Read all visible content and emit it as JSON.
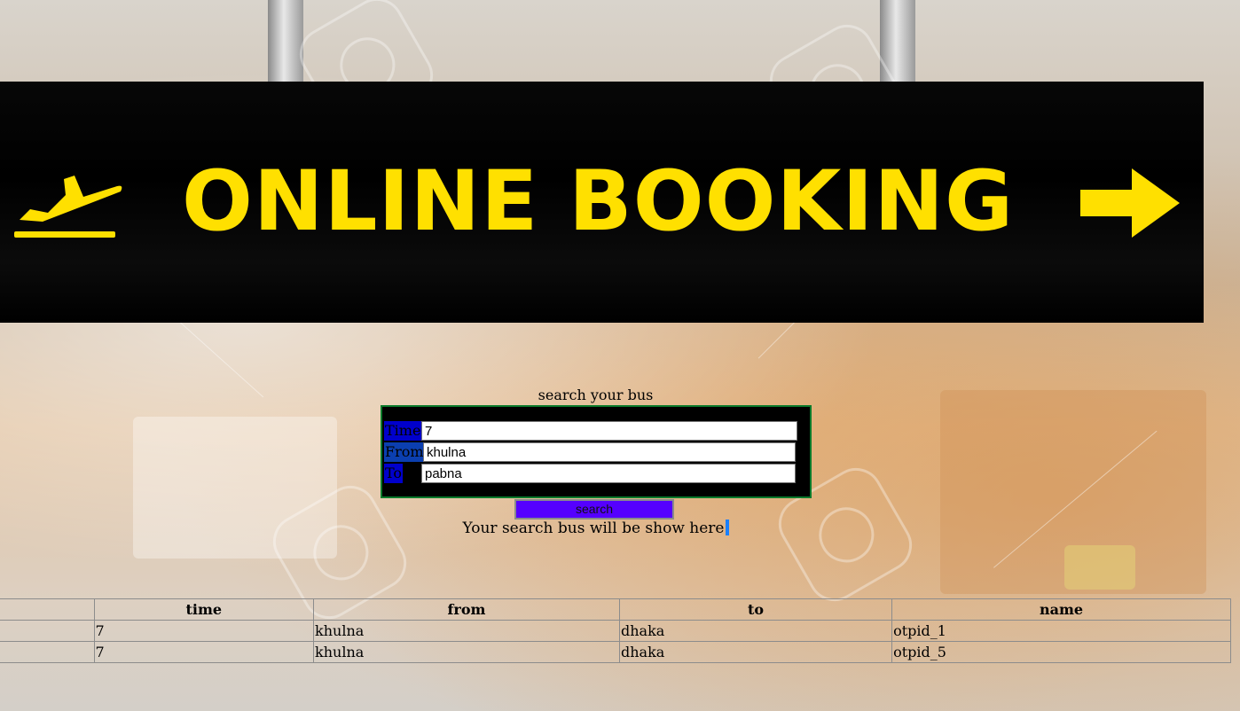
{
  "banner": {
    "title": "ONLINE BOOKING"
  },
  "search": {
    "caption": "search your bus",
    "fields": {
      "time": {
        "label": "Time",
        "value": "7"
      },
      "from": {
        "label": "From",
        "value": "khulna"
      },
      "to": {
        "label": "To",
        "value": "pabna"
      }
    },
    "button_label": "search",
    "result_message": "Your search bus will be show here"
  },
  "results": {
    "columns": [
      "time",
      "from",
      "to",
      "name"
    ],
    "rows": [
      [
        "7",
        "khulna",
        "dhaka",
        "otpid_1"
      ],
      [
        "7",
        "khulna",
        "dhaka",
        "otpid_5"
      ]
    ]
  },
  "colors": {
    "sign_text": "#ffe000",
    "sign_background": "#000000",
    "label_highlight": "#0000cc",
    "button": "#5500ff",
    "form_border": "#0a7a2b"
  },
  "icons": [
    "departure-plane-icon",
    "right-arrow-icon"
  ]
}
